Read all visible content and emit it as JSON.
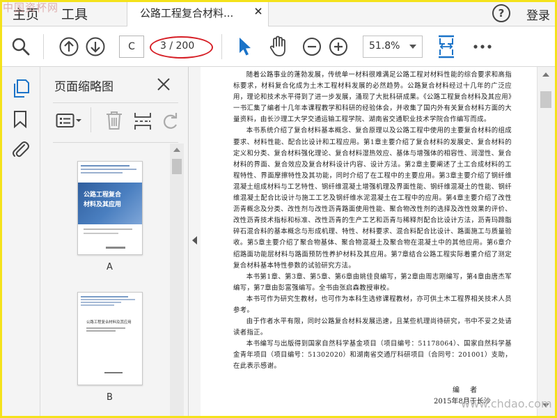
{
  "watermarks": {
    "top": "中国资杯网",
    "bottom": "www.chdao.com"
  },
  "tabs": {
    "home_label": "主页",
    "tools_label": "工具",
    "document_title": "公路工程复合材料...",
    "login_label": "登录"
  },
  "toolbar": {
    "page_input_value": "C",
    "page_count": "3 / 200",
    "zoom_value": "51.8%"
  },
  "thumbnail_panel": {
    "title": "页面缩略图",
    "pages": [
      {
        "label": "A",
        "cover_title_line1": "公路工程复合",
        "cover_title_line2": "材料及其应用"
      },
      {
        "label": "B",
        "title_line": "公路工程复合材料及其应用"
      }
    ]
  },
  "document": {
    "paragraphs": [
      "随着公路事业的蓬勃发展，传统单一材料很难满足公路工程对材料性能的综合要求和高指标要求，材料复合化成为土木工程材料发展的必然趋势。公路复合材料经过十几年的广泛应用，理论和技术水平得到了进一步发展，涌现了大批科研成果。《公路工程复合材料及其应用》一书汇集了编者十几年本课程教学和科研的经验体会，并收集了国内外有关复合材料方面的大量资料，由长沙理工大学交通运输工程学院、湖南省交通职业技术学院合作编写而成。",
      "本书系统介绍了复合材料基本概念、复合原理以及公路工程中使用的主要复合材料的组成要求、材料性能、配合比设计和工程应用。第1章主要介绍了复合材料的发展史、复合材料的定义和分类、复合材料强化理论、复合材料湿热效应、基体与增强体的相容性、润湿性、复合材料的界面、复合效应及复合材料设计内容、设计方法。第2章主要阐述了土工合成材料的工程特性、界面摩擦特性及其功能，同时介绍了在工程中的主要应用。第3章主要介绍了钢纤维混凝土组成材料与工艺特性、钢纤维混凝土增强机理及界面性能、钢纤维混凝土的性能、钢纤维混凝土配合比设计与施工工艺及钢纤维水泥混凝土在工程中的应用。第4章主要介绍了改性沥青概念及分类、改性剂与改性沥青路面使用性能、聚合物改性剂的选择及改性效果的评价、改性沥青技术指标和标准、改性沥青的生产工艺和沥青与稀释剂配合比设计方法，沥青玛蹄脂碎石混合料的基本概念与形成机理、特性、材料要求、混合料配合比设计、路面施工与质量验收。第5章主要介绍了聚合物基体、聚合物混凝土及聚合物在混凝土中的其他应用。第6章介绍路面功能层材料与路面预防性养护材料及其应用。第7章结合公路工程实际着重介绍了测定复合材料基本特性参数的试验研究方法。",
      "本书第1章、第3章、第5章、第6章由姚佳良编写，第2章由周志刚编写，第4章由唐杰军编写，第7章由彭富强编写。全书由张启森教授审校。",
      "本书可作为研究生教材，也可作为本科生选修课程教材，亦可供土木工程界相关技术人员参考。",
      "由于作者水平有限，同时公路复合材料发展迅速，且某些机理尚待研究，书中不妥之处请读者指正。",
      "本书编写与出版得到国家自然科学基金项目（项目编号：51178064）、国家自然科学基金青年项目（项目编号：51302020）和湖南省交通厅科研项目（合同号：201001）支助，在此表示感谢。"
    ],
    "signature": "编  者",
    "date": "2015年8月于长沙"
  },
  "colors": {
    "frame": "#f4e21b",
    "accent_blue": "#1a73c8",
    "oval_red": "#d61f26"
  }
}
